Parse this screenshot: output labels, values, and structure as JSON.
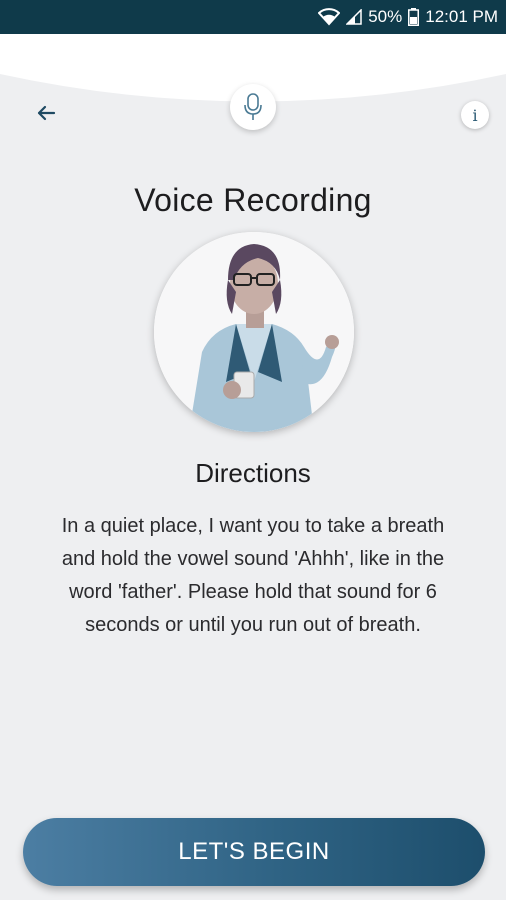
{
  "status_bar": {
    "battery_percent": "50%",
    "time": "12:01 PM",
    "icons": [
      "wifi-icon",
      "signal-icon",
      "battery-icon"
    ]
  },
  "header": {
    "back_icon": "arrow-left-icon",
    "center_icon": "microphone-icon",
    "info_label": "i"
  },
  "main": {
    "title": "Voice Recording",
    "illustration": "person-holding-phone",
    "directions_heading": "Directions",
    "directions_text": "In a quiet place, I want you to take a breath and hold the vowel sound 'Ahhh', like in the word 'father'. Please hold that sound for 6 seconds or until you run out of breath."
  },
  "footer": {
    "begin_label": "LET'S BEGIN"
  },
  "colors": {
    "status_bar": "#0f3a4a",
    "background": "#eeeff1",
    "accent": "#2f6384",
    "icon": "#2b5a74"
  }
}
